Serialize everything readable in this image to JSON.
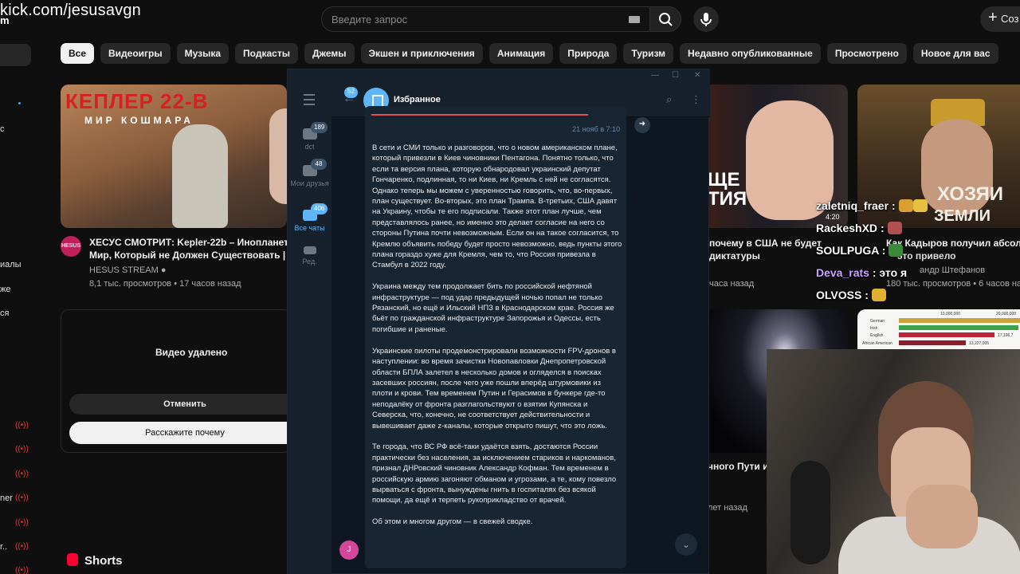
{
  "overlay": {
    "stream_url": "kick.com/jesusavgn",
    "stream_url_fragment": "m"
  },
  "header": {
    "search_placeholder": "Введите запрос",
    "create_label": "Соз",
    "create_plus": "+"
  },
  "chips": [
    "Все",
    "Видеоигры",
    "Музыка",
    "Подкасты",
    "Джемы",
    "Экшен и приключения",
    "Анимация",
    "Природа",
    "Туризм",
    "Недавно опубликованные",
    "Просмотрено",
    "Новое для вас"
  ],
  "sidebar_fragments": [
    "с",
    "иалы",
    "же",
    "ся",
    "ner",
    "r.."
  ],
  "video_main": {
    "thumb_title": "КЕПЛЕР 22-В",
    "thumb_subtitle": "МИР КОШМАРА",
    "avatar_text": "HESUS",
    "title_line1": "ХЕСУС СМОТРИТ: Kepler-22b – Инопланетн",
    "title_line2": "Мир, Который не Должен Существовать | ...",
    "channel": "HESUS STREAM",
    "meta": "8,1 тыс. просмотров • 17 часов назад"
  },
  "removed_card": {
    "text": "Видео удалено",
    "undo": "Отменить",
    "why": "Расскажите почему"
  },
  "shorts": {
    "label": "Shorts"
  },
  "video_right1": {
    "thumb_text_line1": "ЩЕ",
    "thumb_text_line2": "ТИЯ",
    "title_line1": "почему в США не будет",
    "title_line2": "диктатуры",
    "meta": "часа назад"
  },
  "video_right2": {
    "thumb_text_line1": "ХОЗЯИ",
    "thumb_text_line2": "ЗЕМЛИ РУСС",
    "title": "Как Кадыров получил абсолю",
    "subtitle": "это привело",
    "channel": "андр Штефанов",
    "meta": "180 тыс. просмотров • 6 часов на"
  },
  "video_galaxy": {
    "title": "чного Пути и",
    "meta": "лет назад"
  },
  "chart_thumb": {
    "ticks": [
      "10,000,000",
      "20,000,000"
    ],
    "rows": [
      {
        "label": "German",
        "value": ""
      },
      {
        "label": "Irish",
        "value": ""
      },
      {
        "label": "English",
        "value": "17,196,7"
      },
      {
        "label": "African American",
        "value": "13,227,005"
      }
    ]
  },
  "chat": [
    {
      "user": "zaletniq_fraer",
      "text": ":",
      "color": "#ffffff",
      "time": "4:20"
    },
    {
      "user": "RackeshXD",
      "text": ":",
      "color": "#ffffff"
    },
    {
      "user": "SOULPUGA",
      "text": ":",
      "color": "#ffffff"
    },
    {
      "user": "Deva_rats",
      "text": ": это я",
      "color": "#c9a3ff"
    },
    {
      "user": "OLVOSS",
      "text": ":",
      "color": "#ffffff"
    }
  ],
  "telegram": {
    "folders": [
      {
        "label": "dct",
        "badge": "189"
      },
      {
        "label": "Мои друзья",
        "badge": "48"
      },
      {
        "label": "Все чаты",
        "badge": "406"
      },
      {
        "label": "Ред.",
        "badge": ""
      }
    ],
    "back_badge": "52",
    "chat_title": "Избранное",
    "message_date": "21 нояб в 7:10",
    "user_initial": "J",
    "paragraphs": [
      "В сети и СМИ только и разговоров, что о новом американском плане, который привезли в Киев чиновники Пентагона. Понятно только, что если та версия плана, которую обнародовал украинский депутат Гончаренко, подлинная, то ни Киев, ни Кремль с ней не согласятся. Однако теперь мы можем с уверенностью говорить, что, во-первых, план существует. Во-вторых, это план Трампа. В-третьих, США давят на Украину, чтобы те его подписали. Также этот план лучше, чем представлялось ранее, но именно это делает согласие на него со стороны Путина почти невозможным. Если он на такое согласится, то Кремлю объявить победу будет просто невозможно, ведь пункты этого плана гораздо хуже для Кремля, чем то, что Россия привезла в Стамбул в 2022 году.",
      "Украина между тем продолжает бить по российской нефтяной инфраструктуре — под удар предыдущей ночью попал не только Рязанский, но ещё и Ильский НПЗ в Краснодарском крае. Россия же бьёт по гражданской инфраструктуре Запорожья и Одессы, есть погибшие и раненые.",
      "Украинские пилоты продемонстрировали возможности FPV-дронов в наступлении: во время зачистки Новопавловки Днепропетровской области БПЛА залетел в несколько домов и огляделся в поисках засевших россиян, после чего уже пошли вперёд штурмовики из плоти и крови. Тем временем Путин и Герасимов в бункере где-то неподалёку от фронта разглагольствуют о взятии Купянска и Северска, что, конечно, не соответствует действительности и вывешивает даже z-каналы, которые открыто пишут, что это ложь.",
      "Те города, что ВС РФ всё-таки удаётся взять, достаются России практически без населения, за исключением стариков и наркоманов, признал ДНРовский чиновник Александр Кофман. Тем временем в российскую армию загоняют обманом и угрозами, а те, кому повезло вырваться с фронта, вынуждены гнить в госпиталях без всякой помощи, да ещё и терпеть рукоприкладство от врачей.",
      "Об этом и многом другом — в свежей сводке."
    ]
  },
  "colors": {
    "accent_blue": "#5eb5f7",
    "yt_red": "#ff0033",
    "tg_bg": "#0e1621"
  }
}
